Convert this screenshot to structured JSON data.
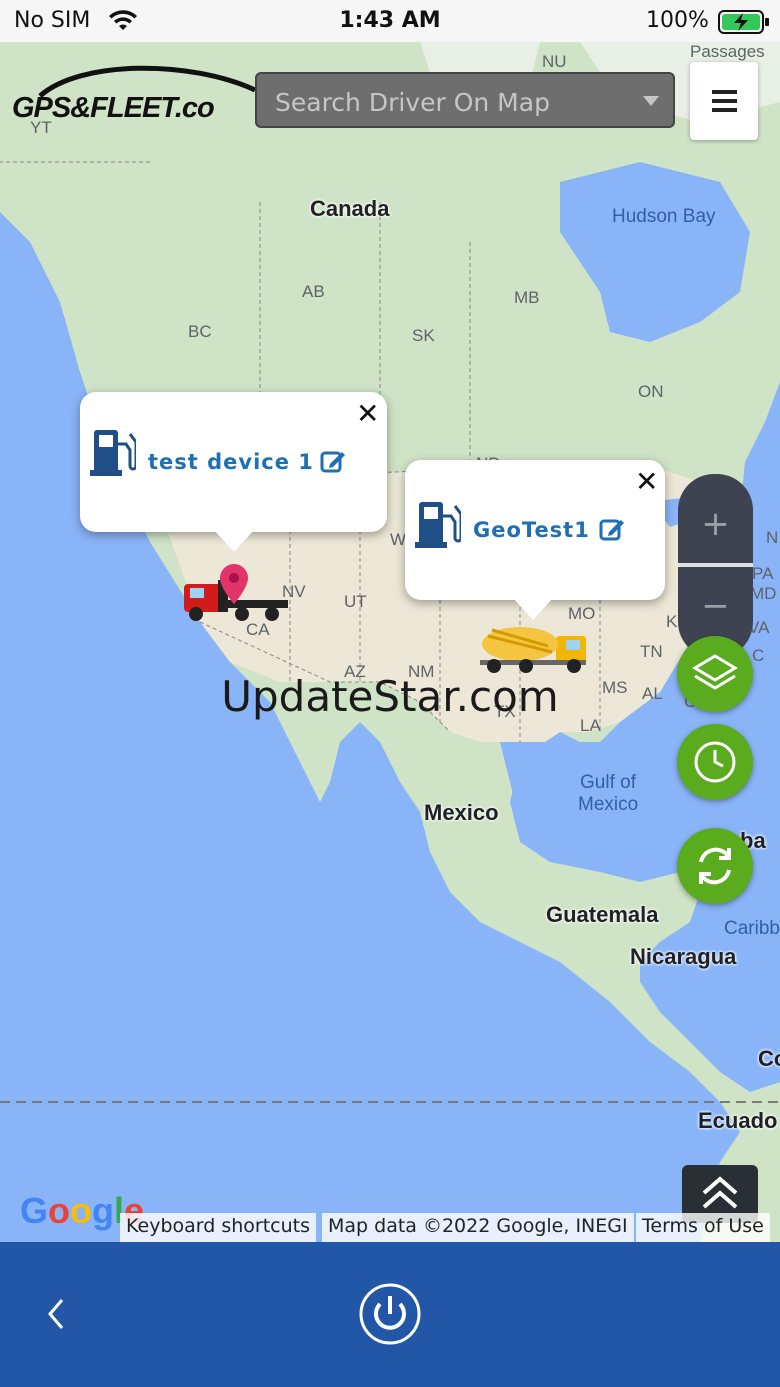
{
  "status_bar": {
    "carrier": "No SIM",
    "time": "1:43 AM",
    "battery_percent": "100%",
    "wifi_icon": "wifi-icon",
    "battery_icon": "battery-charging-icon"
  },
  "header": {
    "logo_text": "GPS&FLEET.co",
    "search_placeholder": "Search Driver On Map",
    "menu_icon": "hamburger-menu-icon"
  },
  "map": {
    "country_labels": [
      "Canada",
      "Mexico",
      "Guatemala",
      "Nicaragua",
      "Ecuado",
      "Co",
      "ba"
    ],
    "water_labels": [
      "Hudson Bay",
      "Gulf of",
      "Mexico",
      "Caribb"
    ],
    "region_labels": [
      "NU",
      "Passages",
      "YT",
      "AB",
      "MB",
      "BC",
      "SK",
      "ON",
      "NV",
      "UT",
      "CA",
      "AZ",
      "NM",
      "TX",
      "MO",
      "KY",
      "VA",
      "TN",
      "MS",
      "AL",
      "LA",
      "PA",
      "MD",
      "W",
      "ND",
      "GA",
      "C",
      "N"
    ],
    "markers": [
      {
        "name": "test device 1",
        "icon": "semi-truck-icon"
      },
      {
        "name": "GeoTest1",
        "icon": "cement-truck-icon"
      }
    ],
    "popups": [
      {
        "title": "test device 1",
        "icon": "fuel-pump-icon",
        "edit_icon": "edit-icon",
        "close": "✕"
      },
      {
        "title": "GeoTest1",
        "icon": "fuel-pump-icon",
        "edit_icon": "edit-icon",
        "close": "✕"
      }
    ],
    "zoom_in": "+",
    "zoom_out": "−",
    "watermark": "UpdateStar.com",
    "attribution": {
      "google": "Google",
      "keyboard": "Keyboard shortcuts",
      "map_data": "Map data ©2022 Google, INEGI",
      "terms": "Terms of Use"
    }
  },
  "colors": {
    "water": "#8ab4f8",
    "land": "#cfe3c6",
    "fab_green": "#5aab1d",
    "bottom_bar": "#2257a8",
    "popup_text": "#1f6fb5"
  },
  "fabs": [
    "layers-icon",
    "clock-icon",
    "refresh-icon"
  ],
  "bottom_bar": {
    "back_icon": "chevron-left-icon",
    "power_icon": "power-icon"
  }
}
